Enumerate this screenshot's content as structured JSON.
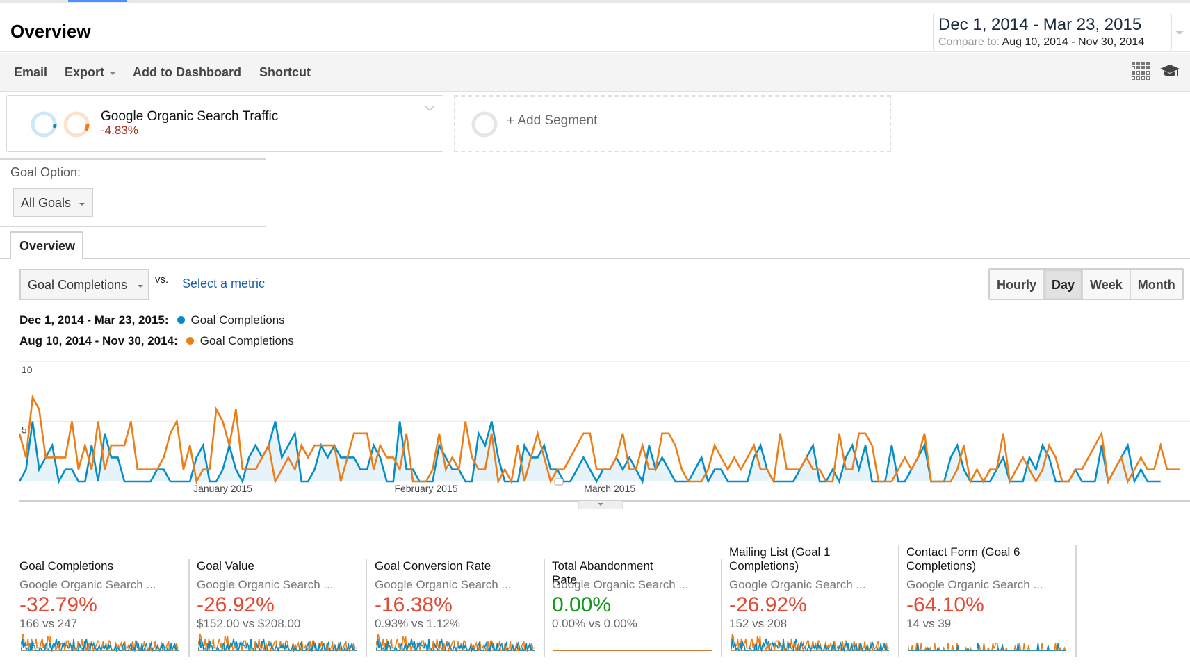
{
  "header": {
    "title": "Overview",
    "date_range": {
      "primary": "Dec 1, 2014 - Mar 23, 2015",
      "compare_label": "Compare to:",
      "compare_range": "Aug 10, 2014 - Nov 30, 2014"
    }
  },
  "toolbar": {
    "email": "Email",
    "export": "Export",
    "add_to_dashboard": "Add to Dashboard",
    "shortcut": "Shortcut",
    "icons": [
      "grid-icon",
      "graduation-cap-icon"
    ]
  },
  "segments": {
    "active": {
      "name": "Google Organic Search Traffic",
      "change": "-4.83%"
    },
    "add_label": "+ Add Segment"
  },
  "goal_option": {
    "label": "Goal Option:",
    "selected": "All Goals"
  },
  "tabs": [
    {
      "label": "Overview",
      "active": true
    }
  ],
  "chart_controls": {
    "metric_selected": "Goal Completions",
    "vs_label": "vs.",
    "select_metric": "Select a metric",
    "periods": [
      {
        "label": "Hourly",
        "active": false
      },
      {
        "label": "Day",
        "active": true
      },
      {
        "label": "Week",
        "active": false
      },
      {
        "label": "Month",
        "active": false
      }
    ]
  },
  "legend": [
    {
      "range": "Dec 1, 2014 - Mar 23, 2015:",
      "metric": "Goal Completions",
      "color": "#058dc7"
    },
    {
      "range": "Aug 10, 2014 - Nov 30, 2014:",
      "metric": "Goal Completions",
      "color": "#ed7e17"
    }
  ],
  "chart_data": {
    "type": "line",
    "title": "",
    "xlabel": "",
    "ylabel": "Goal Completions",
    "ylim": [
      0,
      10
    ],
    "y_ticks": [
      "5",
      "10"
    ],
    "x_tick_labels": [
      {
        "label": "January 2015",
        "index": 31
      },
      {
        "label": "February 2015",
        "index": 62
      },
      {
        "label": "March 2015",
        "index": 90
      }
    ],
    "grid": true,
    "legend_position": "top-left",
    "series": [
      {
        "name": "Dec 1, 2014 - Mar 23, 2015: Goal Completions",
        "color": "#058dc7",
        "fill": true,
        "values": [
          0,
          1,
          5,
          1,
          2,
          3,
          0,
          1,
          1,
          0,
          0,
          3,
          0,
          4,
          2,
          2,
          0,
          0,
          0,
          0,
          0,
          1,
          1,
          0,
          0,
          0,
          0,
          2,
          3,
          0,
          0,
          1,
          3,
          1,
          0,
          2,
          3,
          2,
          3,
          5,
          2,
          3,
          4,
          0,
          0,
          1,
          3,
          2,
          3,
          2,
          2,
          2,
          1,
          1,
          3,
          2,
          0,
          0,
          5,
          1,
          1,
          0,
          0,
          0,
          3,
          2,
          1,
          1,
          0,
          0,
          4,
          3,
          5,
          2,
          0,
          0,
          0,
          3,
          2,
          2,
          3,
          1,
          1,
          0,
          0,
          1,
          2,
          1,
          0,
          1,
          1,
          2,
          1,
          2,
          1,
          0,
          3,
          1,
          2,
          1,
          0,
          0,
          0,
          1,
          2,
          0,
          1,
          1,
          0,
          0,
          0,
          0,
          2,
          3,
          1,
          0,
          0,
          0,
          0,
          1,
          2,
          3,
          0,
          0,
          1,
          0,
          2,
          3,
          1,
          3,
          0,
          0,
          0,
          3,
          0,
          0,
          1,
          2,
          3,
          0,
          0,
          0,
          2,
          3,
          1,
          0,
          0,
          0,
          0,
          1,
          2,
          0,
          0,
          0,
          2,
          1,
          3,
          2,
          0,
          0,
          0,
          1,
          0,
          0,
          0,
          3,
          0,
          1,
          2,
          3,
          0,
          1,
          0,
          0,
          0
        ]
      },
      {
        "name": "Aug 10, 2014 - Nov 30, 2014: Goal Completions",
        "color": "#ed7e17",
        "fill": false,
        "values": [
          4,
          2,
          7,
          6,
          2,
          2,
          2,
          2,
          5,
          1,
          3,
          1,
          5,
          1,
          3,
          3,
          3,
          5,
          1,
          1,
          1,
          1,
          2,
          4,
          5,
          1,
          3,
          0,
          1,
          1,
          6,
          5,
          3,
          6,
          1,
          1,
          1,
          2,
          3,
          0,
          1,
          2,
          1,
          3,
          2,
          3,
          3,
          3,
          3,
          0,
          2,
          4,
          4,
          4,
          1,
          3,
          2,
          2,
          1,
          4,
          0,
          0,
          0,
          1,
          4,
          1,
          2,
          1,
          5,
          2,
          1,
          1,
          4,
          0,
          1,
          0,
          3,
          0,
          2,
          4,
          2,
          0,
          1,
          1,
          2,
          3,
          4,
          4,
          1,
          1,
          1,
          2,
          4,
          1,
          1,
          3,
          1,
          1,
          4,
          4,
          3,
          1,
          0,
          0,
          0,
          1,
          3,
          2,
          1,
          2,
          1,
          2,
          3,
          1,
          1,
          0,
          4,
          1,
          1,
          1,
          2,
          1,
          1,
          0,
          0,
          4,
          1,
          1,
          4,
          4,
          3,
          0,
          0,
          0,
          1,
          2,
          1,
          2,
          4,
          0,
          0,
          0,
          0,
          1,
          3,
          0,
          1,
          0,
          1,
          1,
          4,
          0,
          1,
          2,
          1,
          0,
          1,
          3,
          2,
          0,
          0,
          1,
          1,
          2,
          3,
          4,
          0,
          1,
          2,
          0,
          1,
          2,
          1,
          1,
          3,
          1,
          1,
          1
        ]
      }
    ]
  },
  "scorecards": [
    {
      "title": "Goal Completions",
      "segment": "Google Organic Search ...",
      "change": "-32.79%",
      "change_color": "#e04b36",
      "compare": "166 vs 247",
      "spark_type": "busy"
    },
    {
      "title": "Goal Value",
      "segment": "Google Organic Search ...",
      "change": "-26.92%",
      "change_color": "#e04b36",
      "compare": "$152.00 vs $208.00",
      "spark_type": "busy"
    },
    {
      "title": "Goal Conversion Rate",
      "segment": "Google Organic Search ...",
      "change": "-16.38%",
      "change_color": "#e04b36",
      "compare": "0.93% vs 1.12%",
      "spark_type": "busy"
    },
    {
      "title": "Total Abandonment Rate",
      "segment": "Google Organic Search ...",
      "change": "0.00%",
      "change_color": "#109618",
      "compare": "0.00% vs 0.00%",
      "spark_type": "flat"
    },
    {
      "title": "Mailing List (Goal 1 Completions)",
      "segment": "Google Organic Search ...",
      "change": "-26.92%",
      "change_color": "#e04b36",
      "compare": "152 vs 208",
      "spark_type": "busy"
    },
    {
      "title": "Contact Form (Goal 6 Completions)",
      "segment": "Google Organic Search ...",
      "change": "-64.10%",
      "change_color": "#e04b36",
      "compare": "14 vs 39",
      "spark_type": "sparse"
    }
  ]
}
